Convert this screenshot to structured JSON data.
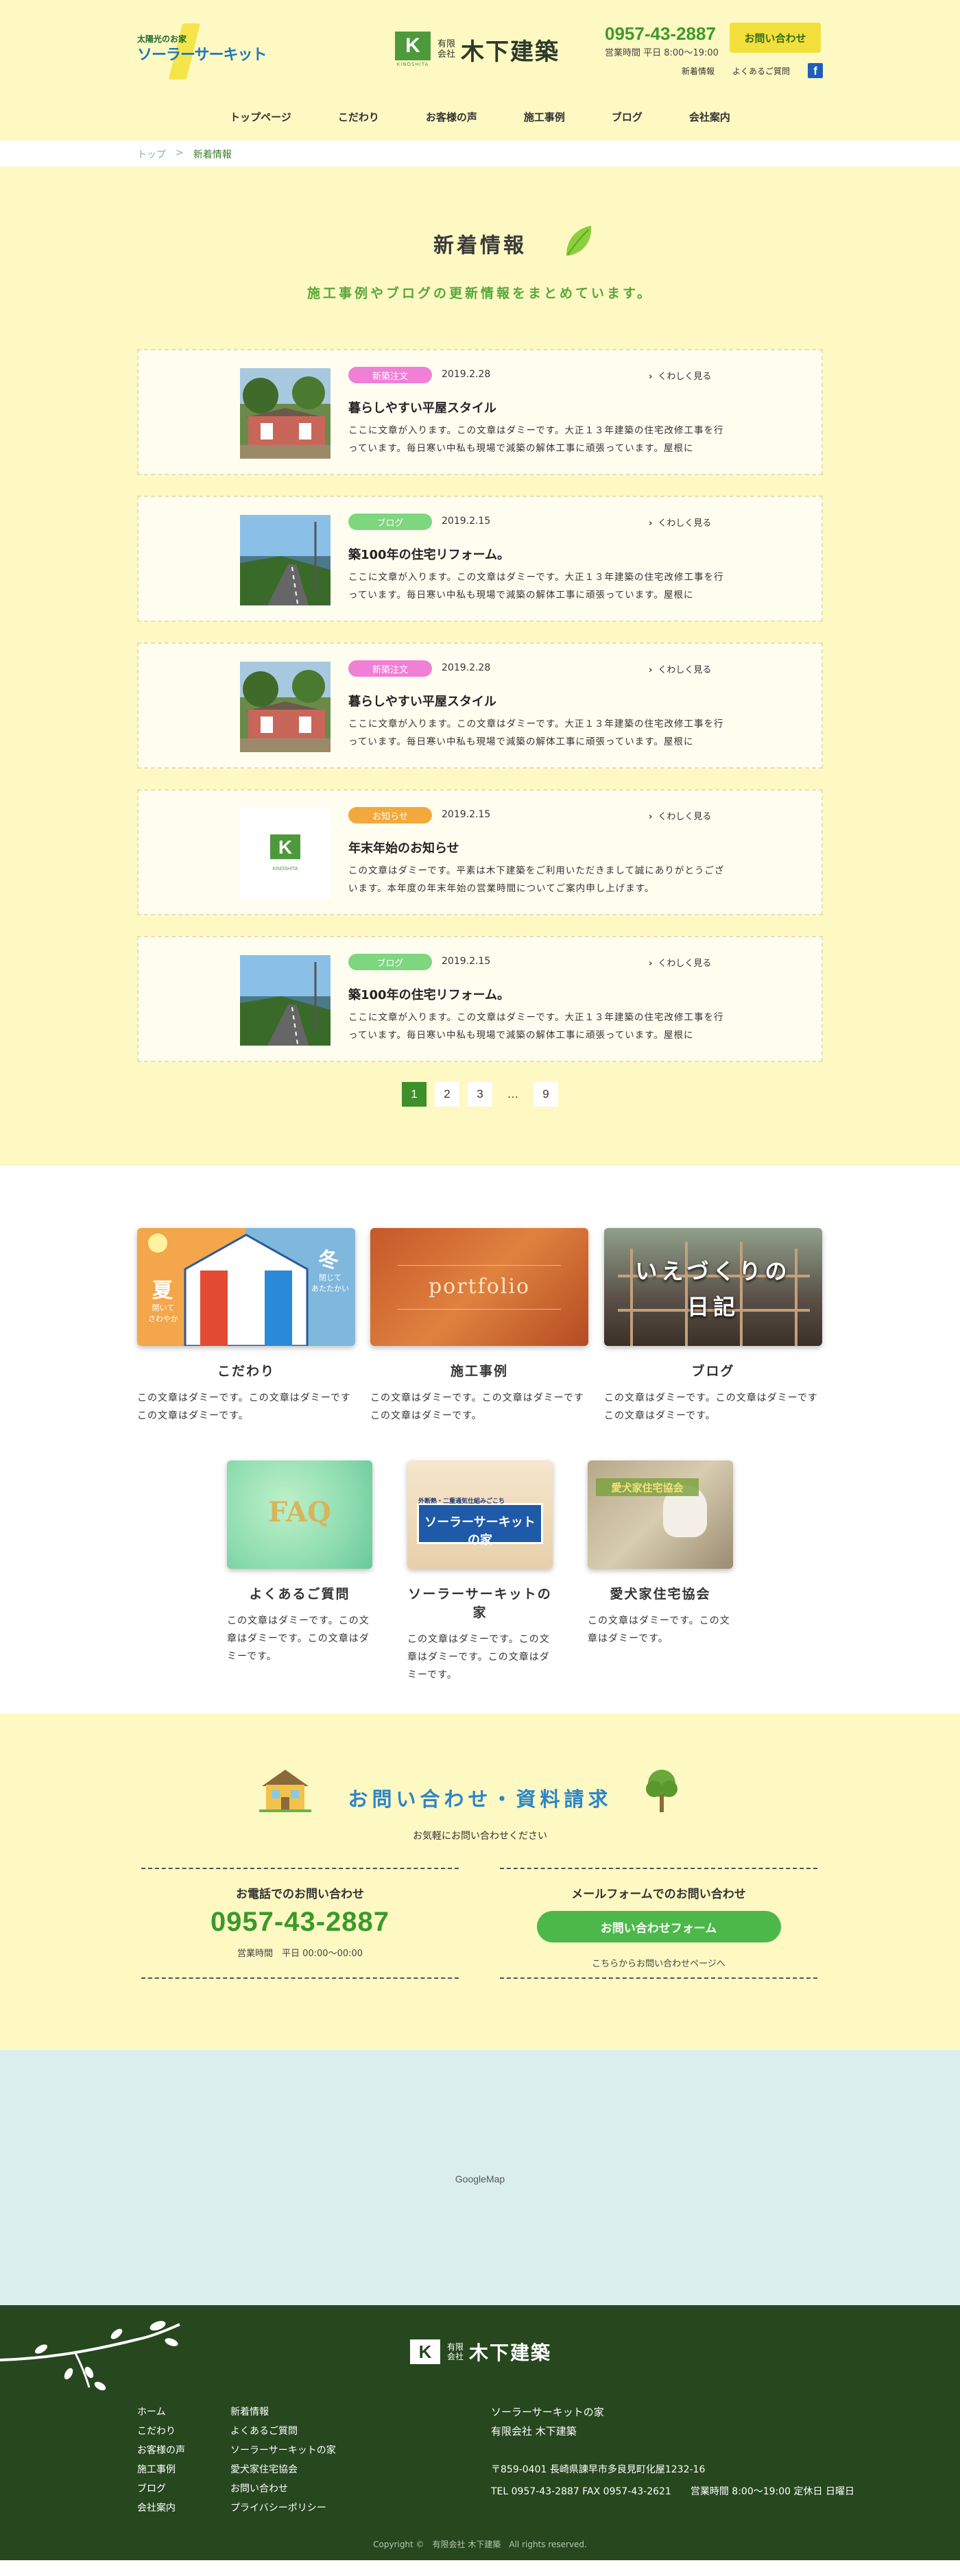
{
  "header": {
    "solar_logo_small": "太陽光のお家",
    "solar_logo_big": "ソーラーサーキット",
    "brand_logo_text": "KINOSHITA",
    "company_type": "有限\n会社",
    "company_name": "木下建築",
    "phone": "0957-43-2887",
    "hours": "営業時間 平日 8:00〜19:00",
    "contact_button": "お問い合わせ",
    "links": [
      "新着情報",
      "よくあるご質問"
    ],
    "fb_letter": "f",
    "nav": [
      "トップページ",
      "こだわり",
      "お客様の声",
      "施工事例",
      "ブログ",
      "会社案内"
    ]
  },
  "breadcrumb": {
    "home": "トップ",
    "sep": ">",
    "current": "新着情報"
  },
  "news": {
    "title": "新着情報",
    "subtitle": "施工事例やブログの更新情報をまとめています。",
    "more_label": "くわしく見る",
    "items": [
      {
        "category": "新築注文",
        "cat_color": "#f07fd6",
        "date": "2019.2.28",
        "title": "暮らしやすい平屋スタイル",
        "excerpt": "ここに文章が入ります。この文章はダミーです。大正１３年建築の住宅改修工事を行っています。毎日寒い中私も現場で減築の解体工事に頑張っています。屋根に",
        "thumb": "house"
      },
      {
        "category": "ブログ",
        "cat_color": "#7ed67e",
        "date": "2019.2.15",
        "title": "築100年の住宅リフォーム。",
        "excerpt": "ここに文章が入ります。この文章はダミーです。大正１３年建築の住宅改修工事を行っています。毎日寒い中私も現場で減築の解体工事に頑張っています。屋根に",
        "thumb": "road"
      },
      {
        "category": "新築注文",
        "cat_color": "#f07fd6",
        "date": "2019.2.28",
        "title": "暮らしやすい平屋スタイル",
        "excerpt": "ここに文章が入ります。この文章はダミーです。大正１３年建築の住宅改修工事を行っています。毎日寒い中私も現場で減築の解体工事に頑張っています。屋根に",
        "thumb": "house"
      },
      {
        "category": "お知らせ",
        "cat_color": "#f2a93b",
        "date": "2019.2.15",
        "title": "年末年始のお知らせ",
        "excerpt": "この文章はダミーです。平素は木下建築をご利用いただきまして誠にありがとうございます。本年度の年末年始の営業時間についてご案内申し上げます。",
        "thumb": "logo"
      },
      {
        "category": "ブログ",
        "cat_color": "#7ed67e",
        "date": "2019.2.15",
        "title": "築100年の住宅リフォーム。",
        "excerpt": "ここに文章が入ります。この文章はダミーです。大正１３年建築の住宅改修工事を行っています。毎日寒い中私も現場で減築の解体工事に頑張っています。屋根に",
        "thumb": "road"
      }
    ],
    "pager": [
      "1",
      "2",
      "3",
      "…",
      "9"
    ],
    "pager_current": "1"
  },
  "features": {
    "row1": [
      {
        "title": "こだわり",
        "desc": "この文章はダミーです。この文章はダミーです この文章はダミーです。",
        "img_text_1": "夏",
        "img_text_1s": "開いて\nさわやか",
        "img_text_2": "冬",
        "img_text_2s": "閉じて\nあたたかい"
      },
      {
        "title": "施工事例",
        "desc": "この文章はダミーです。この文章はダミーです この文章はダミーです。",
        "img_text_1": "portfolio"
      },
      {
        "title": "ブログ",
        "desc": "この文章はダミーです。この文章はダミーです この文章はダミーです。",
        "img_text_1": "いえづくりの",
        "img_text_2": "日記"
      }
    ],
    "row2": [
      {
        "title": "よくあるご質問",
        "desc": "この文章はダミーです。この文章はダミーです。この文章はダミーです。",
        "img_text_1": "FAQ"
      },
      {
        "title": "ソーラーサーキットの家",
        "desc": "この文章はダミーです。この文章はダミーです。この文章はダミーです。",
        "img_text_1": "外断熱・二重通気仕組みごこち",
        "img_text_2": "ソーラーサーキットの家"
      },
      {
        "title": "愛犬家住宅協会",
        "desc": "この文章はダミーです。この文章はダミーです。",
        "img_text_1": "愛犬家住宅協会"
      }
    ]
  },
  "contact": {
    "title": "お問い合わせ・資料請求",
    "subtitle": "お気軽にお問い合わせください",
    "phone_head": "お電話でのお問い合わせ",
    "phone": "0957-43-2887",
    "phone_hours": "営業時間　平日 00:00〜00:00",
    "form_head": "メールフォームでのお問い合わせ",
    "form_button": "お問い合わせフォーム",
    "form_link": "こちらからお問い合わせページへ"
  },
  "map": {
    "label": "GoogleMap"
  },
  "footer": {
    "company_type": "有限\n会社",
    "company_name": "木下建築",
    "nav_col1": [
      "ホーム",
      "こだわり",
      "お客様の声",
      "施工事例",
      "ブログ",
      "会社案内"
    ],
    "nav_col2": [
      "新着情報",
      "よくあるご質問",
      "ソーラーサーキットの家",
      "愛犬家住宅協会",
      "お問い合わせ",
      "プライバシーポリシー"
    ],
    "info_line1": "ソーラーサーキットの家",
    "info_line2": "有限会社 木下建築",
    "address": "〒859-0401 長崎県諫早市多良見町化屋1232-16",
    "tel_line": "TEL 0957-43-2887 FAX 0957-43-2621　　営業時間 8:00〜19:00 定休日 日曜日",
    "copyright": "Copyright ©　有限会社 木下建築　All rights reserved."
  }
}
